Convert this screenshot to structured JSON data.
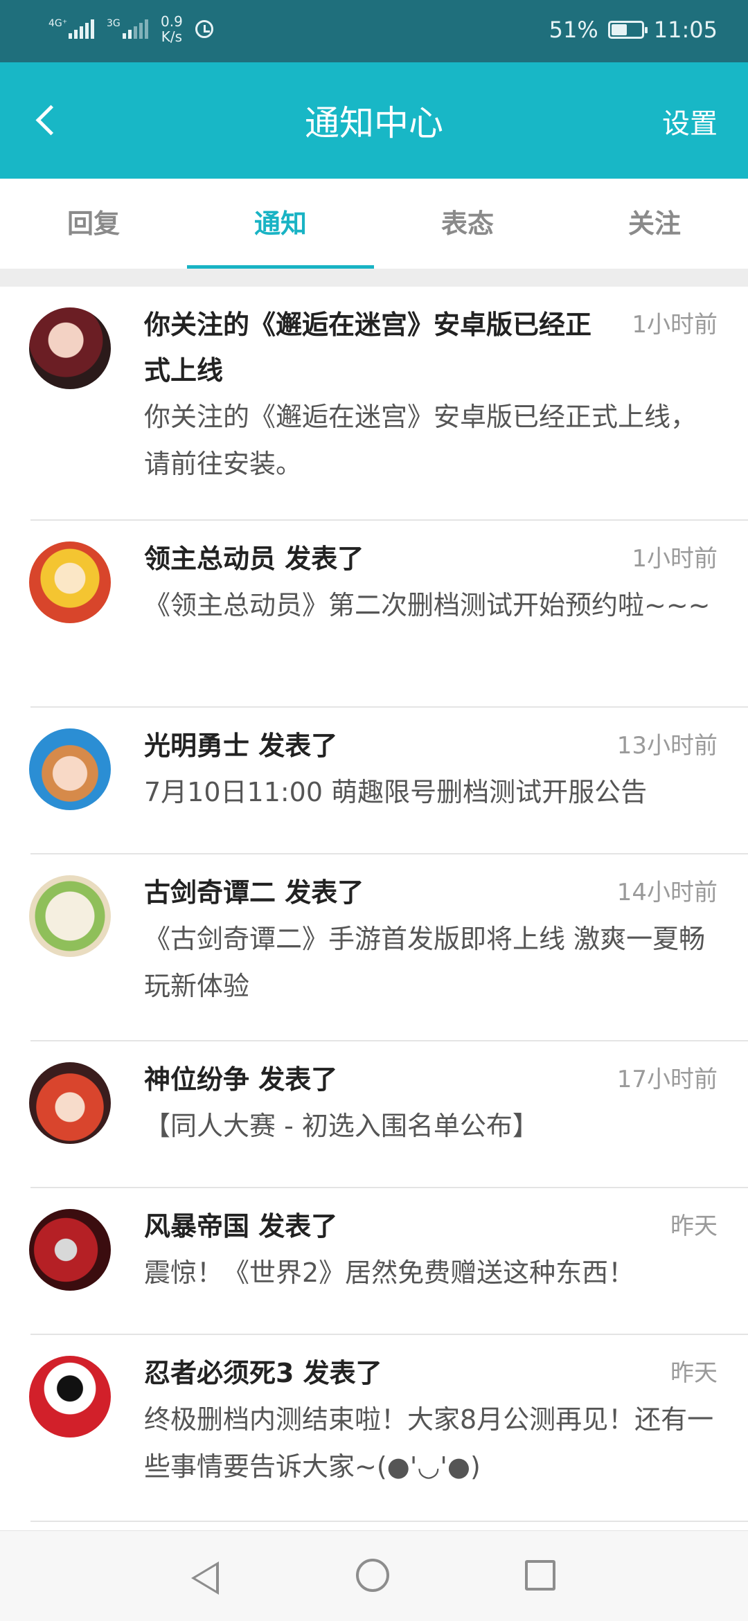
{
  "status_bar": {
    "signal1_label": "4G⁺",
    "signal2_label": "3G",
    "net_speed": "0.9",
    "net_speed_unit": "K/s",
    "battery": "51%",
    "time": "11:05"
  },
  "header": {
    "title": "通知中心",
    "settings_label": "设置"
  },
  "tabs": [
    {
      "label": "回复"
    },
    {
      "label": "通知"
    },
    {
      "label": "表态"
    },
    {
      "label": "关注"
    }
  ],
  "active_tab": "通知",
  "notifications": [
    {
      "title": "你关注的《邂逅在迷宫》安卓版已经正式上线",
      "time": "1小时前",
      "body": "你关注的《邂逅在迷宫》安卓版已经正式上线，请前往安装。"
    },
    {
      "title": "领主总动员 发表了",
      "time": "1小时前",
      "body": "《领主总动员》第二次删档测试开始预约啦~~~"
    },
    {
      "title": "光明勇士 发表了",
      "time": "13小时前",
      "body": "7月10日11:00 萌趣限号删档测试开服公告"
    },
    {
      "title": "古剑奇谭二 发表了",
      "time": "14小时前",
      "body": "《古剑奇谭二》手游首发版即将上线 激爽一夏畅玩新体验"
    },
    {
      "title": "神位纷争 发表了",
      "time": "17小时前",
      "body": "【同人大赛 - 初选入围名单公布】"
    },
    {
      "title": "风暴帝国 发表了",
      "time": "昨天",
      "body": "震惊！《世界2》居然免费赠送这种东西！"
    },
    {
      "title": "忍者必须死3 发表了",
      "time": "昨天",
      "body": "终极删档内测结束啦！大家8月公测再见！还有一些事情要告诉大家~(●'◡'●)"
    }
  ],
  "colors": {
    "status_bar": "#1f6f7c",
    "header": "#18b7c6",
    "accent": "#19b3c4"
  }
}
